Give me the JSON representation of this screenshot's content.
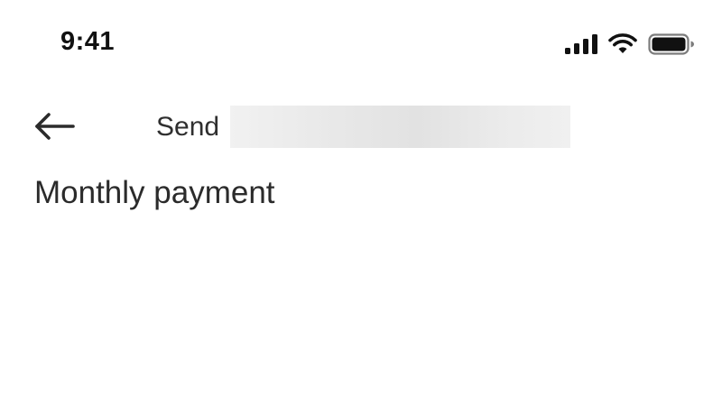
{
  "status_bar": {
    "time": "9:41",
    "signal_icon": "cellular-signal-icon",
    "wifi_icon": "wifi-icon",
    "battery_icon": "battery-icon"
  },
  "header": {
    "back_icon": "arrow-left-icon",
    "send_label": "Send"
  },
  "main": {
    "title": "Monthly payment"
  }
}
